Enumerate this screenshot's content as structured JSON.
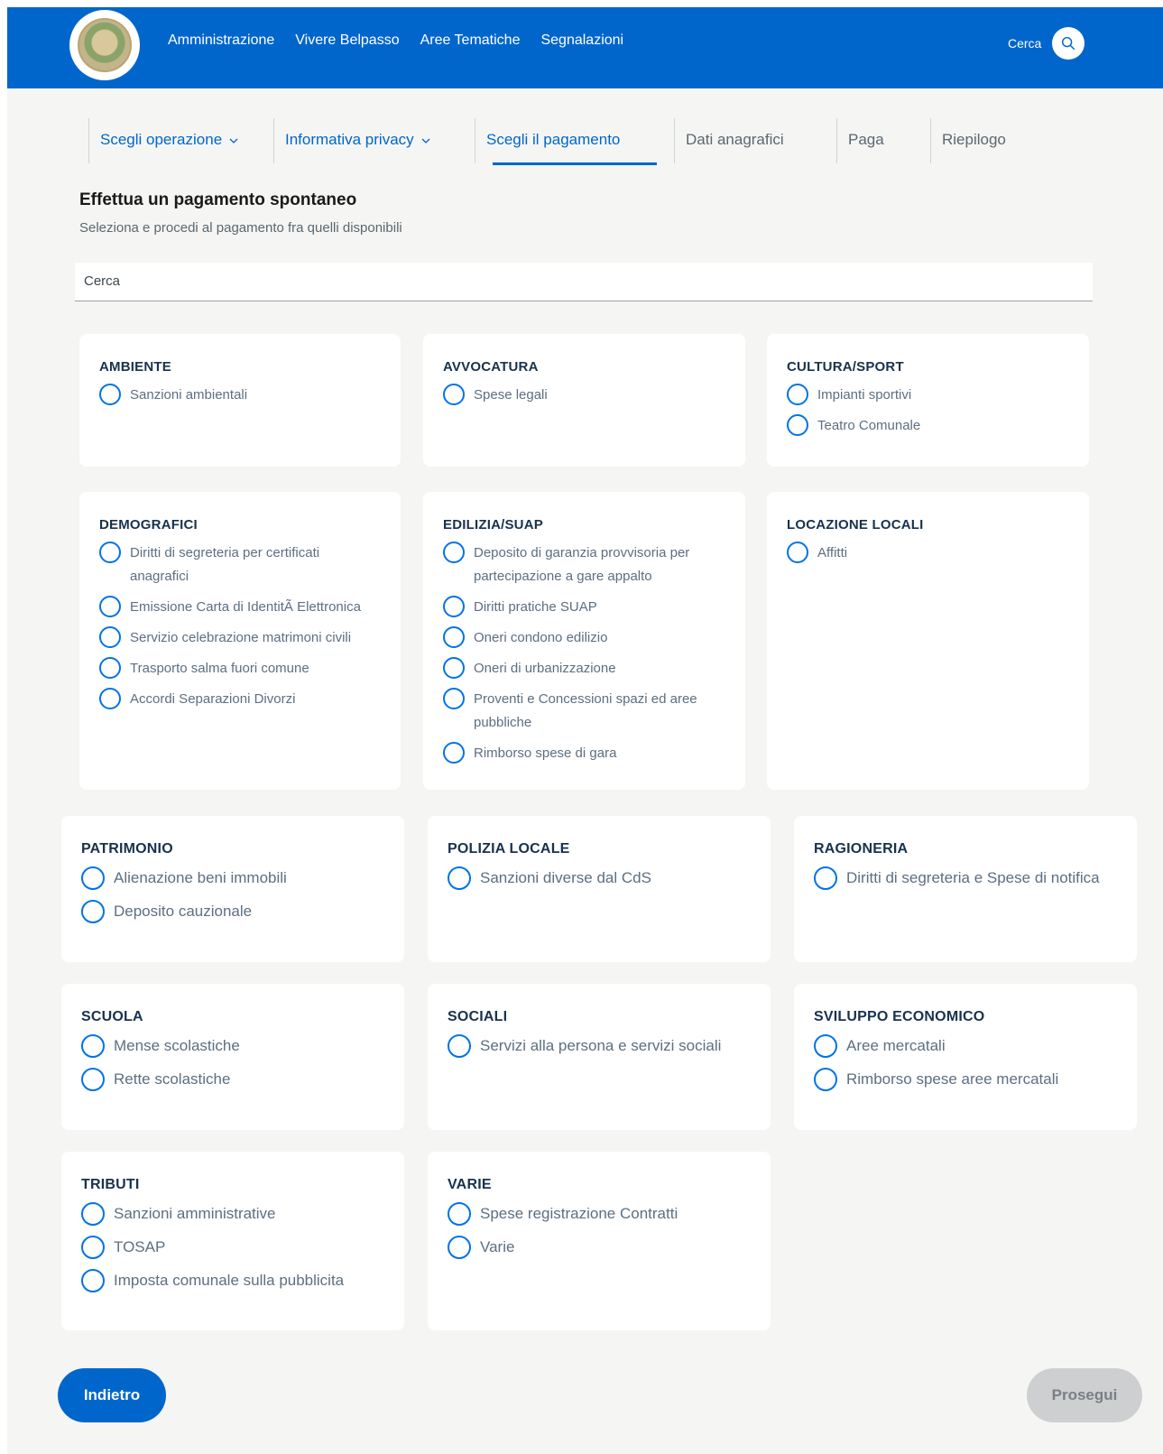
{
  "colors": {
    "primary": "#0066cc",
    "background": "#f5f6f3",
    "disabled": "#cdcfd1"
  },
  "header": {
    "nav": [
      "Amministrazione",
      "Vivere Belpasso",
      "Aree Tematiche",
      "Segnalazioni"
    ],
    "search_label": "Cerca",
    "search_icon": "search-icon"
  },
  "steps": [
    {
      "label": "Scegli operazione",
      "state": "completed"
    },
    {
      "label": "Informativa privacy",
      "state": "completed"
    },
    {
      "label": "Scegli il pagamento",
      "state": "active"
    },
    {
      "label": "Dati anagrafici",
      "state": "pending"
    },
    {
      "label": "Paga",
      "state": "pending"
    },
    {
      "label": "Riepilogo",
      "state": "pending"
    }
  ],
  "main": {
    "title": "Effettua un pagamento spontaneo",
    "subtitle": "Seleziona e procedi al pagamento fra quelli disponibili",
    "search_placeholder": "Cerca"
  },
  "categories": [
    {
      "title": "AMBIENTE",
      "options": [
        "Sanzioni ambientali"
      ]
    },
    {
      "title": "AVVOCATURA",
      "options": [
        "Spese legali"
      ]
    },
    {
      "title": "CULTURA/SPORT",
      "options": [
        "Impianti sportivi",
        "Teatro Comunale"
      ]
    },
    {
      "title": "DEMOGRAFICI",
      "options": [
        "Diritti di segreteria per certificati anagrafici",
        "Emissione Carta di IdentitÃ Elettronica",
        "Servizio celebrazione matrimoni civili",
        "Trasporto salma fuori comune",
        "Accordi Separazioni Divorzi"
      ]
    },
    {
      "title": "EDILIZIA/SUAP",
      "options": [
        "Deposito di garanzia provvisoria per partecipazione a gare appalto",
        "Diritti pratiche SUAP",
        "Oneri condono edilizio",
        "Oneri di urbanizzazione",
        "Proventi e Concessioni spazi ed aree pubbliche",
        "Rimborso spese di gara"
      ]
    },
    {
      "title": "LOCAZIONE LOCALI",
      "options": [
        "Affitti"
      ]
    },
    {
      "title": "PATRIMONIO",
      "options": [
        "Alienazione beni immobili",
        "Deposito cauzionale"
      ]
    },
    {
      "title": "POLIZIA LOCALE",
      "options": [
        "Sanzioni diverse dal CdS"
      ]
    },
    {
      "title": "RAGIONERIA",
      "options": [
        "Diritti di segreteria e Spese di notifica"
      ]
    },
    {
      "title": "SCUOLA",
      "options": [
        "Mense scolastiche",
        "Rette scolastiche"
      ]
    },
    {
      "title": "SOCIALI",
      "options": [
        "Servizi alla persona e servizi sociali"
      ]
    },
    {
      "title": "SVILUPPO ECONOMICO",
      "options": [
        "Aree mercatali",
        "Rimborso spese aree mercatali"
      ]
    },
    {
      "title": "TRIBUTI",
      "options": [
        "Sanzioni amministrative",
        "TOSAP",
        "Imposta comunale sulla pubblicita"
      ]
    },
    {
      "title": "VARIE",
      "options": [
        "Spese registrazione Contratti",
        "Varie"
      ]
    }
  ],
  "buttons": {
    "back": "Indietro",
    "next": "Prosegui"
  }
}
